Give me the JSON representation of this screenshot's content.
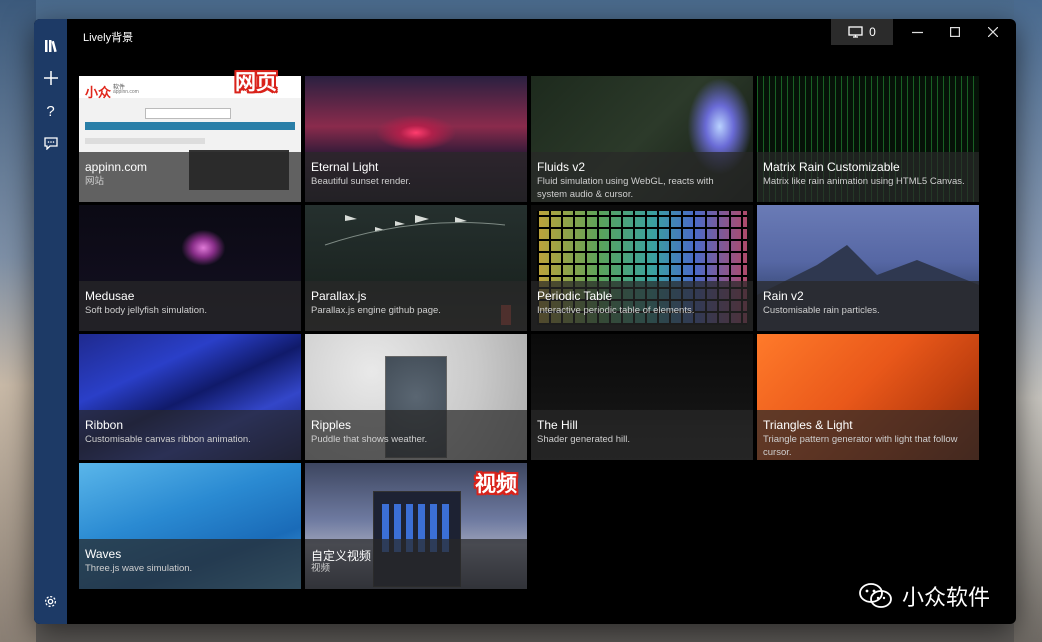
{
  "window": {
    "title": "Lively背景",
    "monitor_count": "0",
    "controls": {
      "minimize": "—",
      "maximize": "☐",
      "close": "✕"
    }
  },
  "sidebar": {
    "icons": [
      "library-icon",
      "add-icon",
      "help-icon",
      "feedback-icon",
      "settings-icon"
    ]
  },
  "tiles": [
    {
      "title": "appinn.com",
      "desc": "网站"
    },
    {
      "title": "Eternal Light",
      "desc": "Beautiful sunset render."
    },
    {
      "title": "Fluids v2",
      "desc": "Fluid simulation using WebGL, reacts with system audio & cursor."
    },
    {
      "title": "Matrix Rain Customizable",
      "desc": "Matrix like rain animation using HTML5 Canvas."
    },
    {
      "title": "Medusae",
      "desc": "Soft body jellyfish simulation."
    },
    {
      "title": "Parallax.js",
      "desc": "Parallax.js engine github page."
    },
    {
      "title": "Periodic Table",
      "desc": "Interactive periodic table of elements."
    },
    {
      "title": "Rain v2",
      "desc": "Customisable rain particles."
    },
    {
      "title": "Ribbon",
      "desc": "Customisable canvas ribbon animation."
    },
    {
      "title": "Ripples",
      "desc": "Puddle that shows weather."
    },
    {
      "title": "The Hill",
      "desc": "Shader generated hill."
    },
    {
      "title": "Triangles & Light",
      "desc": "Triangle pattern generator with light that follow cursor."
    },
    {
      "title": "Waves",
      "desc": "Three.js wave simulation."
    },
    {
      "title": "自定义视频",
      "desc": "视频"
    }
  ],
  "badges": {
    "web": "网页",
    "video": "视频"
  },
  "thumbnail_text": {
    "logo": "小众",
    "logo_sub": "软件",
    "logo_url": "appinn.com"
  },
  "watermark": {
    "text": "小众软件"
  }
}
